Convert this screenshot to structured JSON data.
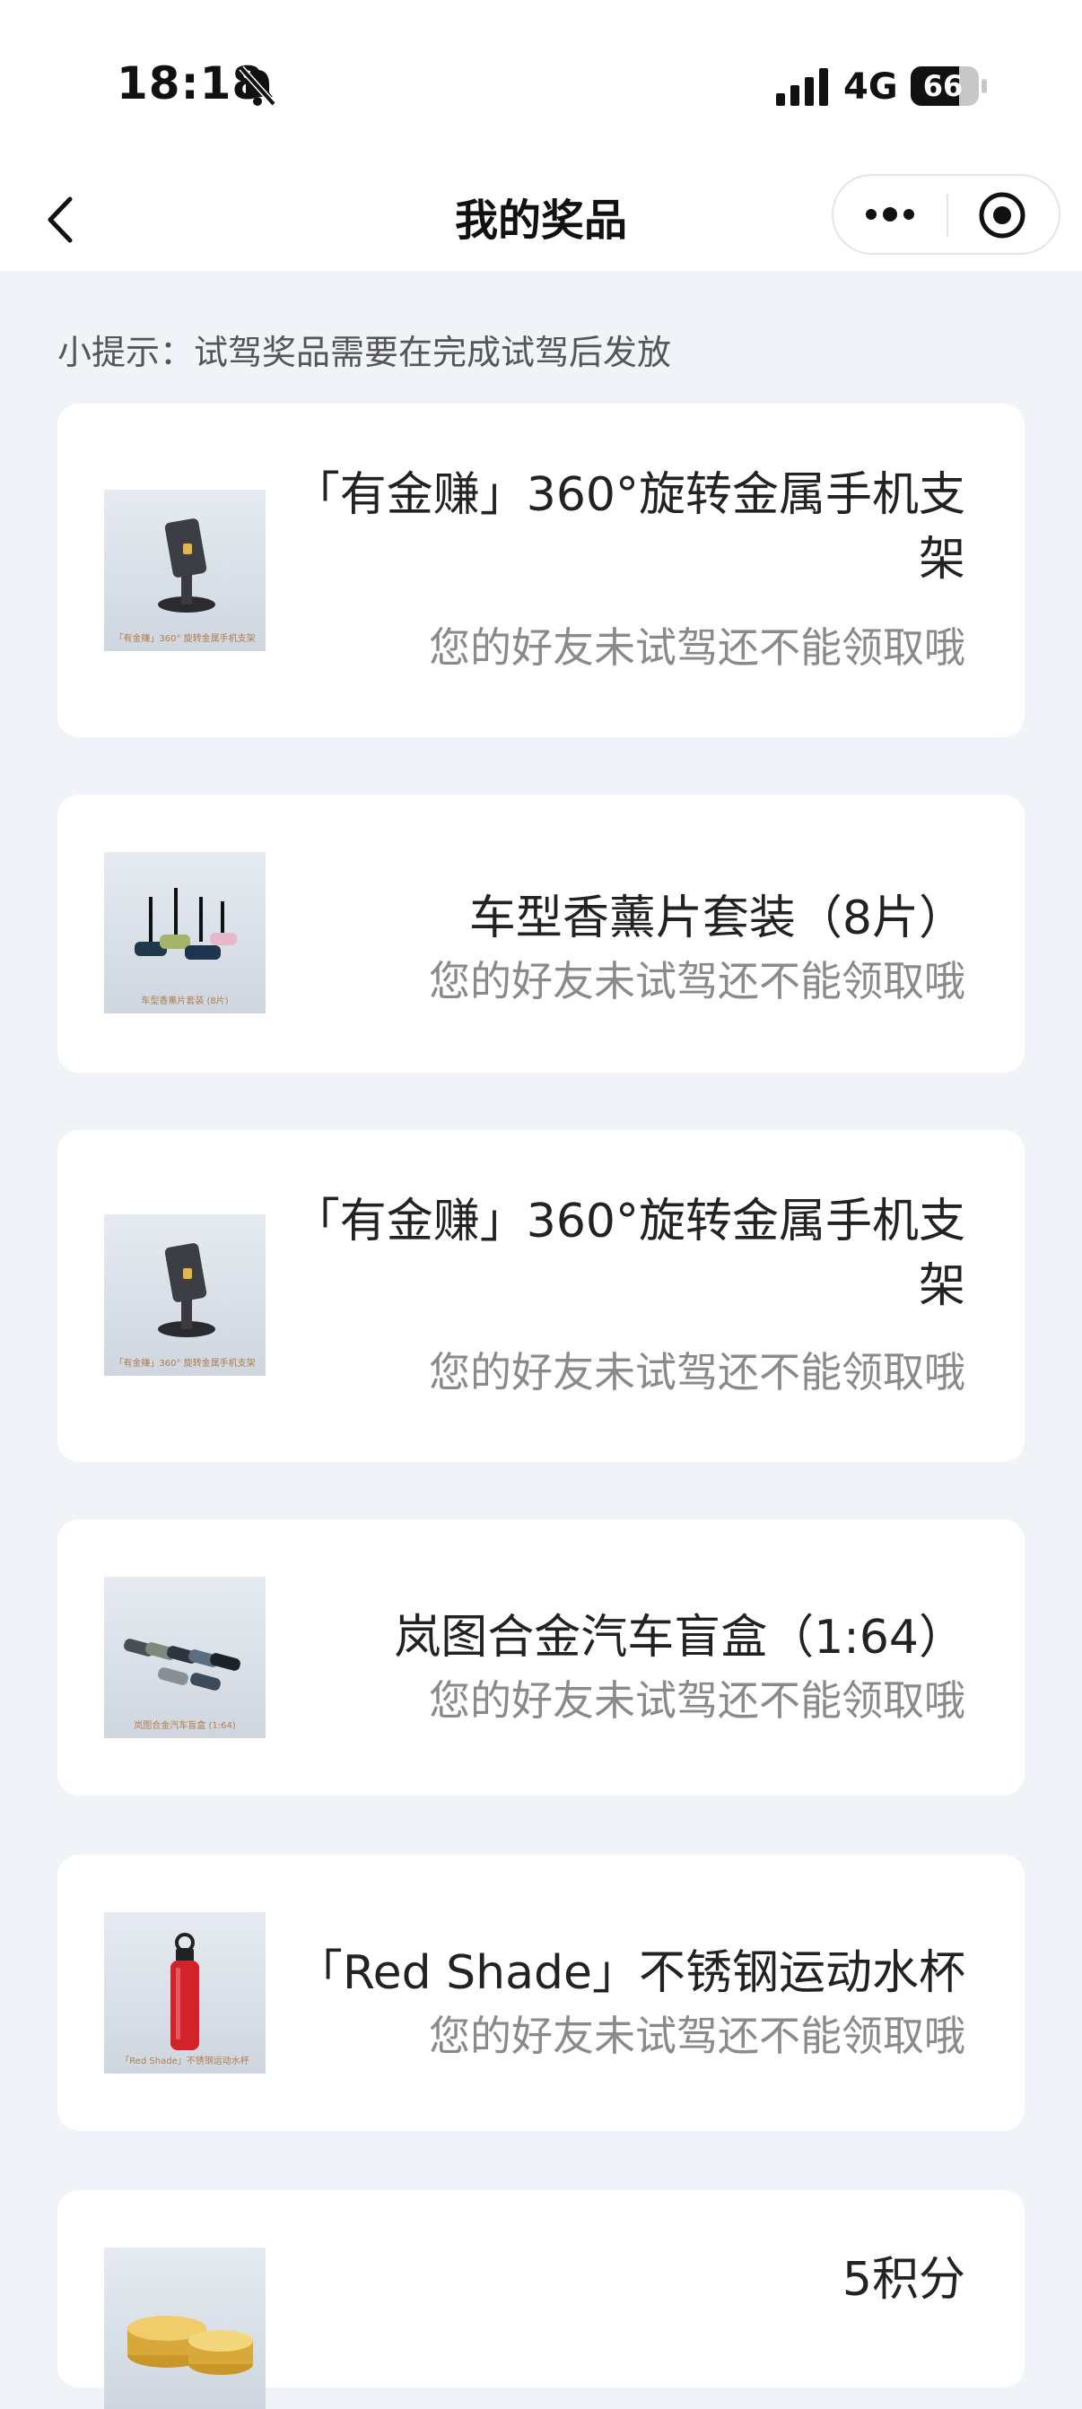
{
  "status_bar": {
    "time": "18:18",
    "network": "4G",
    "battery": "66",
    "icons": [
      "bell-muted-icon",
      "signal-icon",
      "battery-icon"
    ]
  },
  "nav": {
    "title": "我的奖品",
    "icons": [
      "back-arrow-icon",
      "more-dots-icon",
      "close-target-icon"
    ]
  },
  "tip": "小提示：试驾奖品需要在完成试驾后发放",
  "prizes": [
    {
      "name_line1": "「有金赚」360°旋转金属手机支",
      "name_line2": "架",
      "status": "您的好友未试驾还不能领取哦",
      "image_caption": "「有金赚」360° 旋转金属手机支架",
      "image_icon": "phone-stand-image"
    },
    {
      "name_line1": "车型香薰片套装（8片）",
      "name_line2": "",
      "status": "您的好友未试驾还不能领取哦",
      "image_caption": "车型香薰片套装 (8片)",
      "image_icon": "car-aroma-set-image"
    },
    {
      "name_line1": "「有金赚」360°旋转金属手机支",
      "name_line2": "架",
      "status": "您的好友未试驾还不能领取哦",
      "image_caption": "「有金赚」360° 旋转金属手机支架",
      "image_icon": "phone-stand-image"
    },
    {
      "name_line1": "岚图合金汽车盲盒（1:64）",
      "name_line2": "",
      "status": "您的好友未试驾还不能领取哦",
      "image_caption": "岚图合金汽车盲盒 (1:64)",
      "image_icon": "model-cars-image"
    },
    {
      "name_line1": "「Red Shade」不锈钢运动水杯",
      "name_line2": "",
      "status": "您的好友未试驾还不能领取哦",
      "image_caption": "「Red Shade」不锈钢运动水杯",
      "image_icon": "water-bottle-image"
    },
    {
      "name_line1": "5积分",
      "name_line2": "",
      "status": "",
      "image_caption": "",
      "image_icon": "gold-coins-image"
    }
  ],
  "colors": {
    "page_bg": "#f0f3f7",
    "card_bg": "#ffffff",
    "status_text": "#8a8a8a",
    "caption_text": "#b07d4c"
  }
}
